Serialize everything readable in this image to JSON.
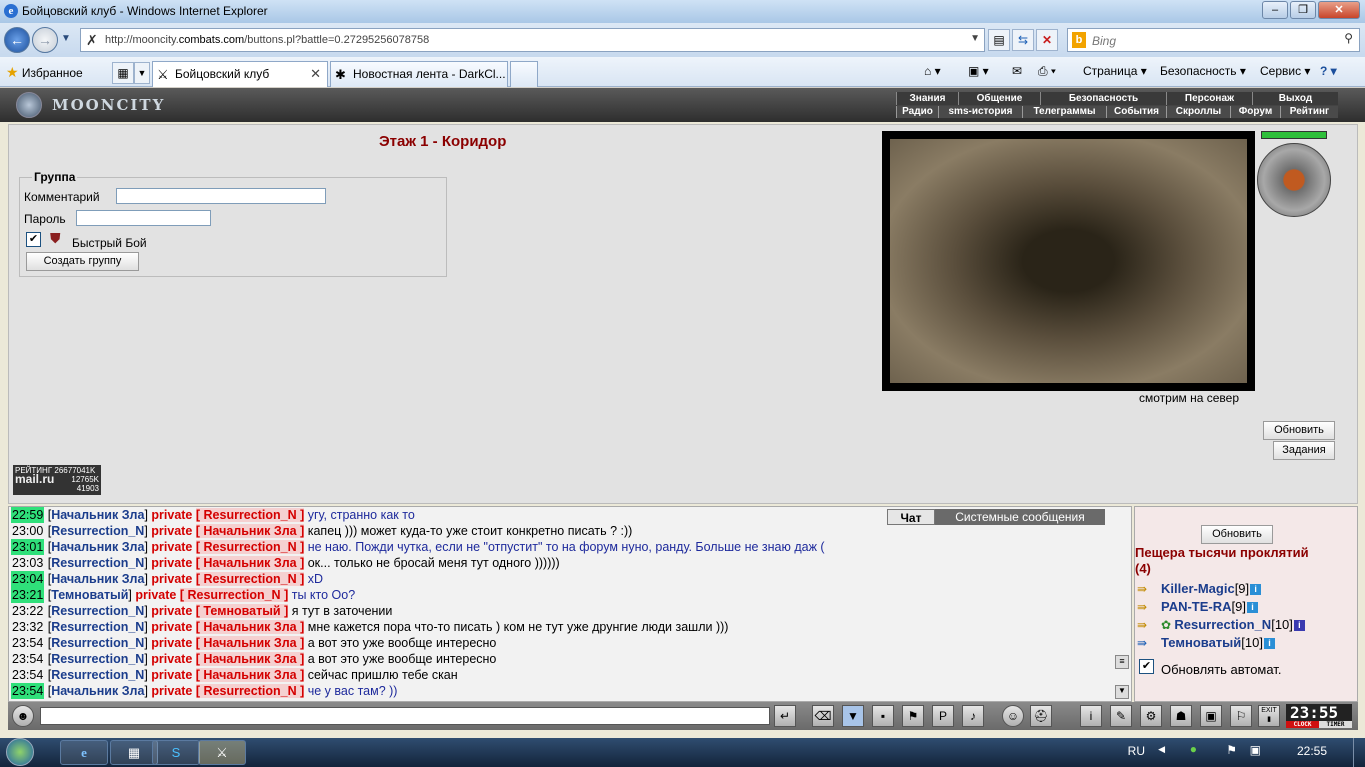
{
  "window": {
    "title": "Бойцовский клуб - Windows Internet Explorer"
  },
  "browser": {
    "url_prefix": "http://mooncity.",
    "url_domain": "combats.com",
    "url_suffix": "/buttons.pl?battle=0.27295256078758",
    "search_placeholder": "Bing",
    "favorites_label": "Избранное",
    "tabs": [
      {
        "label": "Бойцовский клуб"
      },
      {
        "label": "Новостная лента - DarkCl..."
      }
    ],
    "commands": {
      "page": "Страница ▾",
      "safety": "Безопасность ▾",
      "service": "Сервис ▾"
    }
  },
  "game": {
    "logo_text": "MOONCITY",
    "menu_top": [
      "Знания",
      "Общение",
      "Безопасность",
      "Персонаж",
      "Выход"
    ],
    "menu_bottom": [
      "Радио",
      "sms-история",
      "Телеграммы",
      "События",
      "Скроллы",
      "Форум",
      "Рейтинг"
    ],
    "room_title": "Этаж 1 - Коридор",
    "group": {
      "legend": "Группа",
      "comment_label": "Комментарий",
      "password_label": "Пароль",
      "quick_fight_label": "Быстрый Бой",
      "quick_fight_checked": true,
      "create_button": "Создать группу"
    },
    "view": {
      "direction_caption": "смотрим на север"
    },
    "buttons": {
      "refresh": "Обновить",
      "tasks": "Задания"
    },
    "rating_badge": {
      "label": "РЕЙТИНГ",
      "id": "26677041K",
      "brand": "mail.ru",
      "v1": "12765K",
      "v2": "41903"
    }
  },
  "chat": {
    "tabs": {
      "chat": "Чат",
      "system": "Системные сообщения"
    },
    "lines": [
      {
        "time": "22:59",
        "hl": true,
        "from": "Начальник Зла",
        "kind": "private",
        "to": "Resurrection_N",
        "text": "угу, странно как то",
        "blue": true
      },
      {
        "time": "23:00",
        "hl": false,
        "from": "Resurrection_N",
        "kind": "private",
        "to": "Начальник Зла",
        "text": "капец ))) может куда-то уже стоит конкретно писать ? :))",
        "blue": false
      },
      {
        "time": "23:01",
        "hl": true,
        "from": "Начальник Зла",
        "kind": "private",
        "to": "Resurrection_N",
        "text": "не наю. Пожди чутка, если не \"отпустит\" то на форум нуно, ранду. Больше не знаю даж (",
        "blue": true
      },
      {
        "time": "23:03",
        "hl": false,
        "from": "Resurrection_N",
        "kind": "private",
        "to": "Начальник Зла",
        "text": "ок... только не бросай меня тут одного ))))))",
        "blue": false
      },
      {
        "time": "23:04",
        "hl": true,
        "from": "Начальник Зла",
        "kind": "private",
        "to": "Resurrection_N",
        "text": "xD",
        "blue": true
      },
      {
        "time": "23:21",
        "hl": true,
        "from": "Темноватый",
        "kind": "private",
        "to": "Resurrection_N",
        "text": "ты кто Оо?",
        "blue": true
      },
      {
        "time": "23:22",
        "hl": false,
        "from": "Resurrection_N",
        "kind": "private",
        "to": "Темноватый",
        "text": "я тут в заточении",
        "blue": false
      },
      {
        "time": "23:32",
        "hl": false,
        "from": "Resurrection_N",
        "kind": "private",
        "to": "Начальник Зла",
        "text": "мне кажется пора что-то писать ) ком не тут уже друнгие люди зашли )))",
        "blue": false
      },
      {
        "time": "23:54",
        "hl": false,
        "from": "Resurrection_N",
        "kind": "private",
        "to": "Начальник Зла",
        "text": "а вот это уже вообще интересно",
        "blue": false
      },
      {
        "time": "23:54",
        "hl": false,
        "from": "Resurrection_N",
        "kind": "private",
        "to": "Начальник Зла",
        "text": "а вот это уже вообще интересно",
        "blue": false
      },
      {
        "time": "23:54",
        "hl": false,
        "from": "Resurrection_N",
        "kind": "private",
        "to": "Начальник Зла",
        "text": "сейчас пришлю тебе скан",
        "blue": false
      },
      {
        "time": "23:54",
        "hl": true,
        "from": "Начальник Зла",
        "kind": "private",
        "to": "Resurrection_N",
        "text": "че у вас там? ))",
        "blue": true
      }
    ]
  },
  "users_panel": {
    "refresh_button": "Обновить",
    "location": "Пещера тысячи проклятий",
    "count": "(4)",
    "users": [
      {
        "name": "Killer-Magic",
        "level": "[9]"
      },
      {
        "name": "PAN-TE-RA",
        "level": "[9]"
      },
      {
        "name": "Resurrection_N",
        "level": "[10]"
      },
      {
        "name": "Темноватый",
        "level": "[10]"
      }
    ],
    "auto_refresh_label": "Обновлять автомат.",
    "auto_refresh_checked": true
  },
  "toolbar": {
    "clock": "23:55",
    "clock_label": "CLOCK",
    "timer_label": "TIMER",
    "exit_label": "EXIT"
  },
  "taskbar": {
    "lang": "RU",
    "time": "22:55"
  },
  "colors": {
    "accent": "#8b0000",
    "nick": "#1b3d8c",
    "private": "#d40000",
    "time_highlight": "#2fe07a"
  }
}
